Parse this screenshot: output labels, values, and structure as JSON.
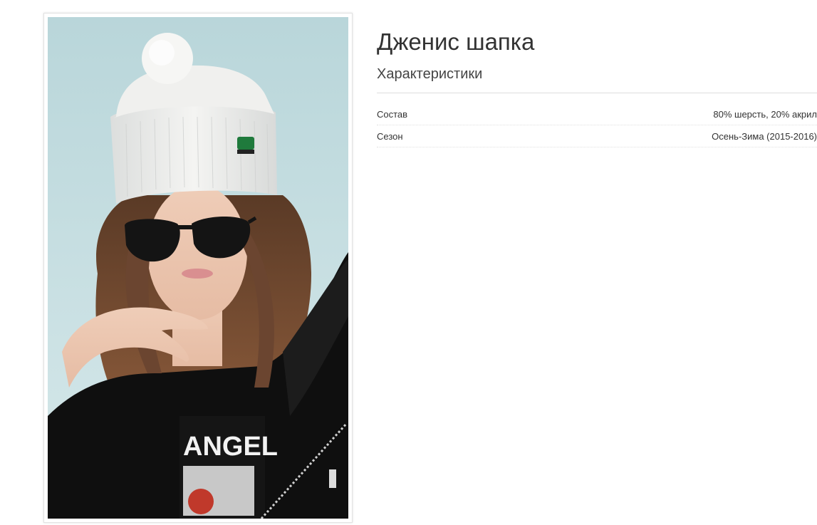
{
  "product": {
    "title": "Дженис шапка",
    "image_alt": "Модель в белой вязаной шапке с помпоном и солнцезащитных очках"
  },
  "specs": {
    "heading": "Характеристики",
    "rows": [
      {
        "label": "Состав",
        "value": "80% шерсть, 20% акрил"
      },
      {
        "label": "Сезон",
        "value": "Осень-Зима (2015-2016)"
      }
    ]
  },
  "colors": {
    "title_text": "#333333",
    "divider": "#dddddd",
    "photo_background": "#c9e1e4"
  }
}
